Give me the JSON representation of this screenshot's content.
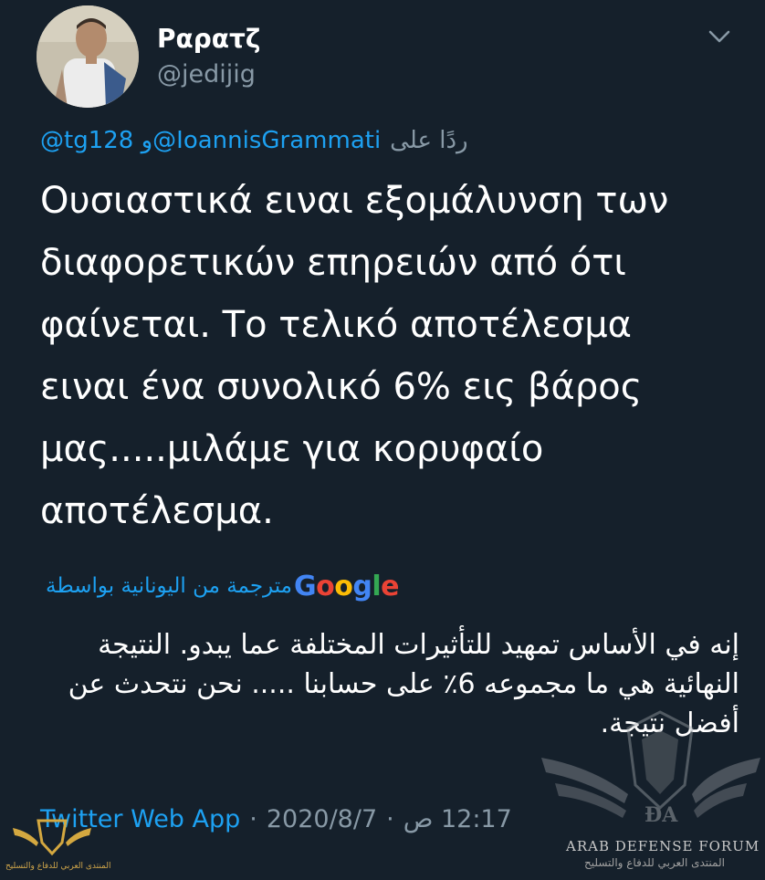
{
  "header": {
    "display_name": "Ραρατζ",
    "handle": "@jedijig",
    "menu_icon": "chevron-down-icon"
  },
  "reply": {
    "prefix": "ردًا على",
    "mentions": "@tg128 و@IoannisGrammati"
  },
  "tweet": {
    "lines": [
      "Ουσιαστικά ειναι εξομάλυνση των",
      "διαφορετικών επηρειών από ότι",
      "φαίνεται. Το τελικό αποτέλεσμα",
      "ειναι ένα συνολικό 6% εις βάρος",
      "μας.....μιλάμε για κορυφαίο",
      "αποτέλεσμα."
    ]
  },
  "translation": {
    "label": "مترجمة من اليونانية بواسطة",
    "provider": "Google",
    "text": "إنه في الأساس تمهيد للتأثيرات المختلفة عما يبدو. النتيجة النهائية هي ما مجموعه 6٪ على حسابنا ..... نحن نتحدث عن أفضل نتيجة."
  },
  "meta": {
    "time": "12:17 ص",
    "date": "2020/8/7",
    "source": "Twitter Web App",
    "separator": "·"
  },
  "watermark": {
    "title": "ARAB DEFENSE FORUM",
    "subtitle": "المنتدى العربي للدفاع والتسليح",
    "corner_caption": "المنتدى العربي للدفاع والتسليح"
  },
  "colors": {
    "background": "#15202b",
    "link": "#1da1f2",
    "secondary": "#8899a6"
  }
}
